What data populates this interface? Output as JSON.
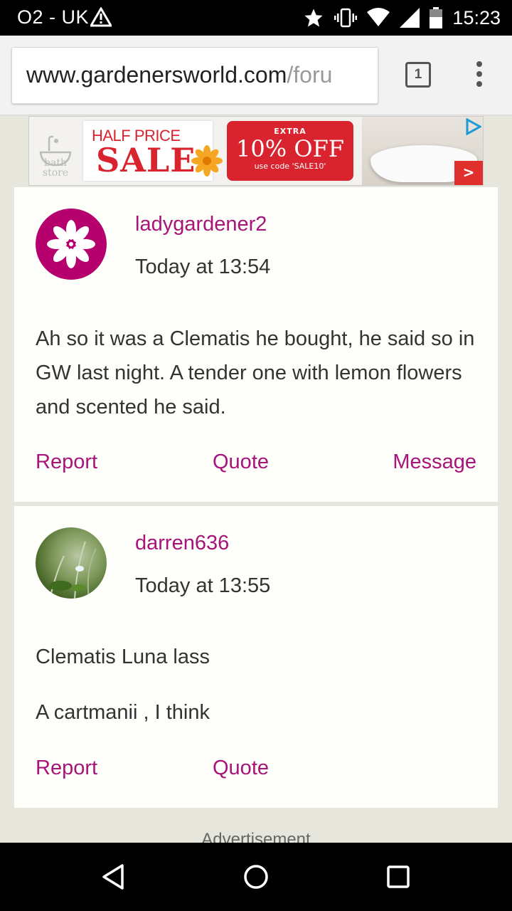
{
  "status_bar": {
    "carrier": "O2 - UK",
    "time": "15:23",
    "icons": [
      "warning-icon",
      "star-icon",
      "vibrate-icon",
      "wifi-icon",
      "signal-icon",
      "battery-icon"
    ]
  },
  "browser": {
    "url_domain": "www.gardenersworld.com",
    "url_path": "/foru",
    "tab_count": "1",
    "menu_icon": "more-vert-icon"
  },
  "ad_banner": {
    "brand_line1": "bath",
    "brand_line2": "store",
    "half_price": "HALF PRICE",
    "sale": "SALE",
    "extra": "EXTRA",
    "offer": "10% OFF",
    "code": "use code 'SALE10'",
    "arrow": ">",
    "accent_color": "#d9232e"
  },
  "posts": [
    {
      "username": "ladygardener2",
      "timestamp": "Today at 13:54",
      "body": "Ah so it was a Clematis he bought, he said so in GW last night. A tender one with lemon flowers and scented he said.",
      "actions": {
        "report": "Report",
        "quote": "Quote",
        "message": "Message"
      }
    },
    {
      "username": "darren636",
      "timestamp": "Today at 13:55",
      "body_line1": "Clematis Luna lass",
      "body_line2": "A cartmanii , I think",
      "actions": {
        "report": "Report",
        "quote": "Quote"
      }
    }
  ],
  "advertisement_label": "Advertisement",
  "colors": {
    "link": "#a7147a",
    "page_bg": "#e6e6dc",
    "card_bg": "#fefefa"
  }
}
